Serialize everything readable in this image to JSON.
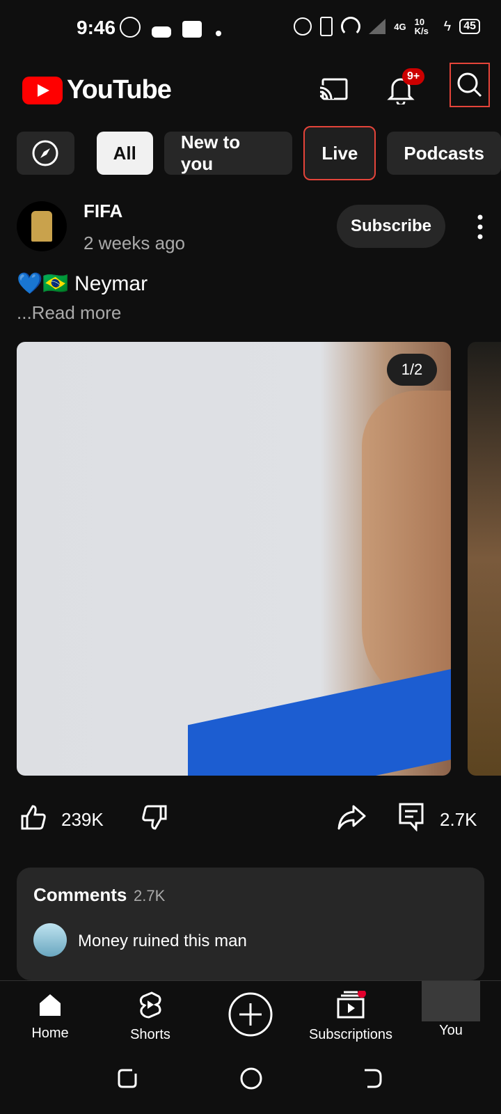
{
  "status_bar": {
    "time": "9:46",
    "left_icons": [
      "whatsapp-icon",
      "game-icon",
      "teams-icon",
      "dot-icon"
    ],
    "right_icons": [
      "alarm-icon",
      "vibrate-icon",
      "hotspot-icon",
      "signal-icon",
      "4g-icon",
      "charging-icon"
    ],
    "network_speed": "10 K/s",
    "network_type": "4G",
    "battery": "45"
  },
  "header": {
    "app_name": "YouTube",
    "notification_badge": "9+",
    "brand_color": "#ff0000"
  },
  "chips": [
    "All",
    "New to you",
    "Live",
    "Podcasts"
  ],
  "post": {
    "channel": "FIFA",
    "posted": "2 weeks ago",
    "subscribe_label": "Subscribe",
    "text": "💙🇧🇷 Neymar",
    "read_more": "...Read more",
    "pager": "1/2",
    "likes": "239K",
    "comments_count": "2.7K"
  },
  "comments": {
    "title": "Comments",
    "count": "2.7K",
    "top_comment": "Money ruined this man"
  },
  "nav": {
    "home": "Home",
    "shorts": "Shorts",
    "subscriptions": "Subscriptions",
    "you": "You"
  }
}
